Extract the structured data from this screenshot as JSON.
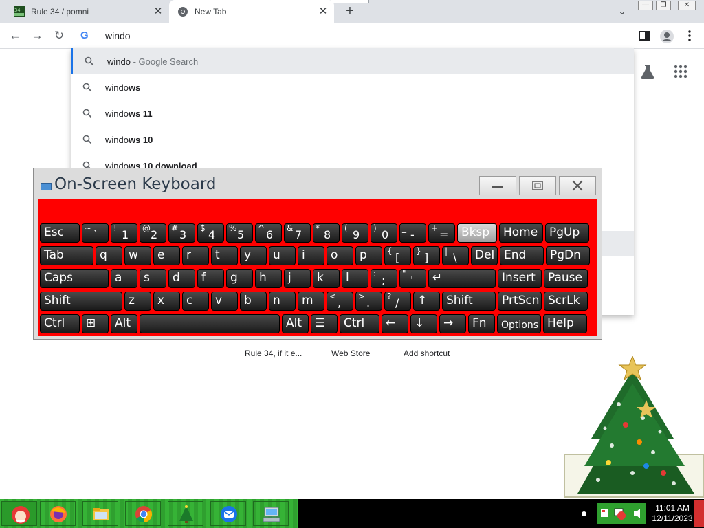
{
  "browser": {
    "tabs": [
      {
        "title": "Rule 34 / pomni",
        "favicon": "r34-favicon"
      },
      {
        "title": "New Tab",
        "favicon": "chrome-icon"
      }
    ],
    "newtab_label": "+",
    "omnibox_text": "windo"
  },
  "suggestions": [
    {
      "prefix": "windo",
      "bold": "",
      "suffix": " - Google Search"
    },
    {
      "prefix": "windo",
      "bold": "ws",
      "suffix": ""
    },
    {
      "prefix": "windo",
      "bold": "ws 11",
      "suffix": ""
    },
    {
      "prefix": "windo",
      "bold": "ws 10",
      "suffix": ""
    },
    {
      "prefix": "windo",
      "bold": "ws 10 download",
      "suffix": ""
    }
  ],
  "shortcuts": [
    "Rule 34, if it e...",
    "Web Store",
    "Add shortcut"
  ],
  "osk": {
    "title": "On-Screen Keyboard",
    "keys_row1": [
      {
        "main": "Esc"
      },
      {
        "top": "~",
        "bot": "`"
      },
      {
        "top": "!",
        "bot": "1"
      },
      {
        "top": "@",
        "bot": "2"
      },
      {
        "top": "#",
        "bot": "3"
      },
      {
        "top": "$",
        "bot": "4"
      },
      {
        "top": "%",
        "bot": "5"
      },
      {
        "top": "^",
        "bot": "6"
      },
      {
        "top": "&",
        "bot": "7"
      },
      {
        "top": "*",
        "bot": "8"
      },
      {
        "top": "(",
        "bot": "9"
      },
      {
        "top": ")",
        "bot": "0"
      },
      {
        "top": "_",
        "bot": "-"
      },
      {
        "top": "+",
        "bot": "="
      },
      {
        "main": "Bksp"
      },
      {
        "main": "Home"
      },
      {
        "main": "PgUp"
      }
    ],
    "keys_row2": [
      {
        "main": "Tab"
      },
      {
        "main": "q"
      },
      {
        "main": "w"
      },
      {
        "main": "e"
      },
      {
        "main": "r"
      },
      {
        "main": "t"
      },
      {
        "main": "y"
      },
      {
        "main": "u"
      },
      {
        "main": "i"
      },
      {
        "main": "o"
      },
      {
        "main": "p"
      },
      {
        "top": "{",
        "bot": "["
      },
      {
        "top": "}",
        "bot": "]"
      },
      {
        "top": "|",
        "bot": "\\"
      },
      {
        "main": "Del"
      },
      {
        "main": "End"
      },
      {
        "main": "PgDn"
      }
    ],
    "keys_row3": [
      {
        "main": "Caps"
      },
      {
        "main": "a"
      },
      {
        "main": "s"
      },
      {
        "main": "d"
      },
      {
        "main": "f"
      },
      {
        "main": "g"
      },
      {
        "main": "h"
      },
      {
        "main": "j"
      },
      {
        "main": "k"
      },
      {
        "main": "l"
      },
      {
        "top": ":",
        "bot": ";"
      },
      {
        "top": "\"",
        "bot": "'"
      },
      {
        "main": "↵"
      },
      {
        "main": "Insert"
      },
      {
        "main": "Pause"
      }
    ],
    "keys_row4": [
      {
        "main": "Shift"
      },
      {
        "main": "z"
      },
      {
        "main": "x"
      },
      {
        "main": "c"
      },
      {
        "main": "v"
      },
      {
        "main": "b"
      },
      {
        "main": "n"
      },
      {
        "main": "m"
      },
      {
        "top": "<",
        "bot": ","
      },
      {
        "top": ">",
        "bot": "."
      },
      {
        "top": "?",
        "bot": "/"
      },
      {
        "main": "↑"
      },
      {
        "main": "Shift"
      },
      {
        "main": "PrtScn"
      },
      {
        "main": "ScrLk"
      }
    ],
    "keys_row5": [
      {
        "main": "Ctrl"
      },
      {
        "main": "⊞"
      },
      {
        "main": "Alt"
      },
      {
        "main": ""
      },
      {
        "main": "Alt"
      },
      {
        "main": "☰"
      },
      {
        "main": "Ctrl"
      },
      {
        "main": "←"
      },
      {
        "main": "↓"
      },
      {
        "main": "→"
      },
      {
        "main": "Fn"
      },
      {
        "main": "Options"
      },
      {
        "main": "Help"
      }
    ],
    "highlighted_key": "Bksp"
  },
  "taskbar": {
    "apps": [
      "firefox-icon",
      "file-explorer-icon",
      "chrome-icon",
      "christmas-tree-icon",
      "thunderbird-icon",
      "on-screen-keyboard-icon"
    ],
    "time": "11:01 AM",
    "date": "12/11/2023"
  }
}
